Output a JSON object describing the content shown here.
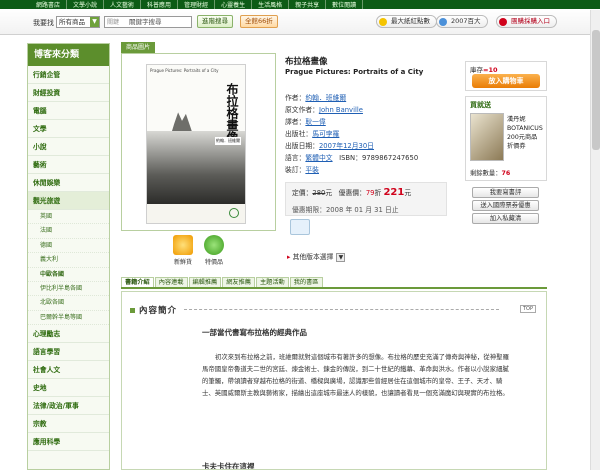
{
  "topnav": {
    "items": [
      "網路書店",
      "文學小說",
      "人文藝術",
      "科普應用",
      "管理財經",
      "心靈養生",
      "生活風格",
      "親子共享",
      "數位閱讀"
    ]
  },
  "searchbar": {
    "label": "我要找",
    "scope": "所有商品",
    "keyword_tag": "關鍵",
    "placeholder": "關鍵字搜尋",
    "search_button": "進階搜尋",
    "promo": "全館66折",
    "pill_points": "最大紙紅點數",
    "pill_year": "2007百大",
    "pill_entry": "團購採購入口"
  },
  "sidebar": {
    "title": "博客來分類",
    "categories_top": [
      "行銷企管",
      "財經投資",
      "電腦",
      "文學",
      "小說",
      "藝術",
      "休閒娛樂",
      "觀光旅遊"
    ],
    "subcategories": [
      "英國",
      "法國",
      "德國",
      "義大利",
      "中歐各國",
      "伊比利半島各國",
      "北歐各國",
      "巴爾幹半島等國"
    ],
    "selected_sub": 4,
    "categories_bottom": [
      "心理勵志",
      "語言學習",
      "社會人文",
      "史地",
      "法律/政治/軍事",
      "宗教",
      "應用科學"
    ]
  },
  "product": {
    "tag": "商品圖片",
    "title_zh": "布拉格畫像",
    "title_en": "Prague Pictures: Portraits of a City",
    "author_label": "作者：",
    "author": "約翰．班維爾",
    "orig_author_label": "原文作者：",
    "orig_author": "John Banville",
    "translator_label": "譯者：",
    "translator": "耿一偉",
    "publisher_label": "出版社：",
    "publisher": "馬可孛羅",
    "date_label": "出版日期：",
    "date": "2007年12月30日",
    "language_label": "語言：",
    "language": "繁體中文",
    "isbn_label": "ISBN：",
    "isbn": "9789867247650",
    "binding_label": "裝訂：",
    "binding": "平裝",
    "cover_en": "Prague Pictures: Portraits of a City",
    "cover_zh": "布拉格畫像",
    "cover_author": "約翰．班維爾"
  },
  "price": {
    "list_label": "定價：",
    "list_price": "280",
    "unit": "元",
    "discount_label": "優惠價：",
    "discount": "79",
    "discount_unit": "折",
    "sale_price": "221",
    "period_label": "優惠期限：",
    "period": "2008 年 01 月 31 日止"
  },
  "icons_row": {
    "new_label": "新鮮貨",
    "special_label": "特價品"
  },
  "version_select": "其他版本選擇",
  "right": {
    "stock_label": "庫存",
    "stock": "=10",
    "cart_button": "放入購物車",
    "gift_title": "買就送",
    "gift_text_1": "漢丹妮",
    "gift_text_2": "BOTANICUS",
    "gift_text_3": "200元商品",
    "gift_text_4": "折價券",
    "remain_label": "剩餘數量：",
    "remain": "76",
    "buttons": [
      "我要寫書評",
      "送入國際票券優惠",
      "加入私藏清"
    ]
  },
  "tabs": [
    "書籍介紹",
    "內容連載",
    "編輯推薦",
    "網友推薦",
    "主題活動",
    "我的書區"
  ],
  "content": {
    "section": "內容簡介",
    "top": "TOP",
    "headline": "一部當代書寫布拉格的經典作品",
    "paragraph": "初次來到布拉格之前，班維爾就對這個城市有著許多的想像。布拉格的歷史充滿了傳奇與神秘，從神聖羅馬帝國皇帝魯道夫二世的宮廷、煉金術士、鍊金的傳說，到二十世紀的鐵幕、革命與洪水。作者以小說家細膩的筆觸，帶領讀者穿越布拉格的街道、橋樑與廣場，認識那些曾經居住在這個城市的皇帝、王子、天才、騎士、英國威爾斯主教與藝術家，描繪出這座城市最迷人的樣貌，也讓讀者看見一個充滿魔幻與現實的布拉格。",
    "subhead": "卡夫卡住在這裡"
  }
}
